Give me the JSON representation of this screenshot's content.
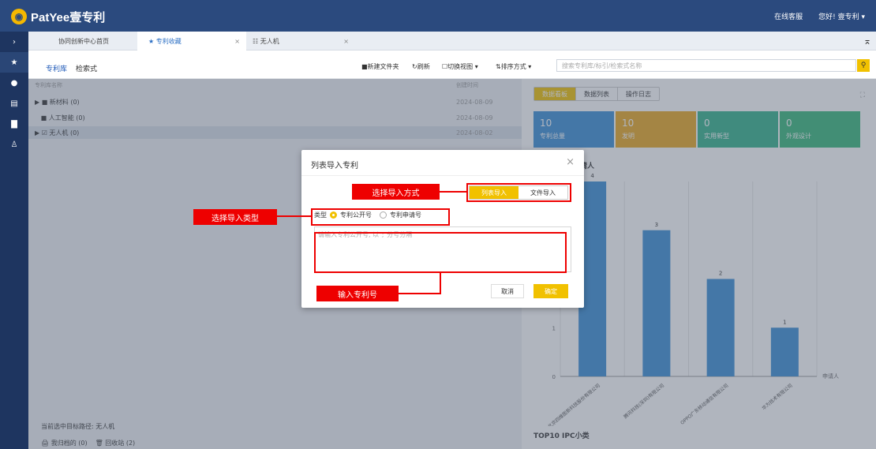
{
  "app": {
    "brand": "PatYee壹专利",
    "online_service": "在线客服",
    "greeting": "您好! 壹专利 ▾"
  },
  "tabs": [
    {
      "label": "协同创新中心首页"
    },
    {
      "label": "★ 专利收藏"
    },
    {
      "label": "☷ 无人机"
    }
  ],
  "tab_close": "×",
  "subtabs": {
    "library": "专利库",
    "search": "检索式"
  },
  "toolbar": {
    "new_folder": "■新建文件夹",
    "refresh": "↻刷新",
    "view": "☐切换视图 ▾",
    "sort": "⇅排序方式 ▾"
  },
  "search": {
    "placeholder": "搜索专利库/标引/检索式名称"
  },
  "table": {
    "header_name": "专利库名称",
    "header_date": "创建时间",
    "rows": [
      {
        "name": "▶ ■ 新材料 (0)",
        "date": "2024-08-09"
      },
      {
        "name": "   ■ 人工智能 (0)",
        "date": "2024-08-09"
      },
      {
        "name": "▶ ☑ 无人机 (0)",
        "date": "2024-08-02"
      }
    ]
  },
  "footer": {
    "path": "当前选中目标路径: 无人机",
    "archive": "我归档的 (0)",
    "recycle": "回收站 (2)"
  },
  "dashboard": {
    "tabs": [
      "数据看板",
      "数据列表",
      "操作日志"
    ],
    "cards": [
      {
        "value": "10",
        "label": "专利总量",
        "color": "#3b8fd6"
      },
      {
        "value": "10",
        "label": "发明",
        "color": "#e9a821"
      },
      {
        "value": "0",
        "label": "实用新型",
        "color": "#33b28a"
      },
      {
        "value": "0",
        "label": "外观设计",
        "color": "#38b87a"
      }
    ],
    "chart_title": "请人",
    "bottom_title": "TOP10 IPC小类"
  },
  "chart_data": {
    "type": "bar",
    "categories": [
      "北京四维图新科技股份有限公司",
      "腾讯科技(深圳)有限公司",
      "OPPO广东移动通信有限公司",
      "华为技术有限公司"
    ],
    "category_labels": [
      "北京四维图新科技股份有限公司",
      "腾讯科技(深圳)有限公司",
      "OPPO广东移动通信有限公司",
      "华为技术有限公司"
    ],
    "values": [
      4,
      3,
      2,
      1
    ],
    "xlabel": "申请人",
    "ylim": [
      0,
      4
    ],
    "yticks": [
      "0",
      "1"
    ],
    "color": "#3b8fd6"
  },
  "dialog": {
    "title": "列表导入专利",
    "close": "×",
    "mode_list": "列表导入",
    "mode_file": "文件导入",
    "type_label": "类型",
    "opt_public": "专利公开号",
    "opt_apply": "专利申请号",
    "textarea_placeholder": "请输入专利公开号, 以\";\"分号分隔",
    "cancel": "取消",
    "ok": "确定"
  },
  "annotations": {
    "mode": "选择导入方式",
    "type": "选择导入类型",
    "number": "输入专利号"
  }
}
